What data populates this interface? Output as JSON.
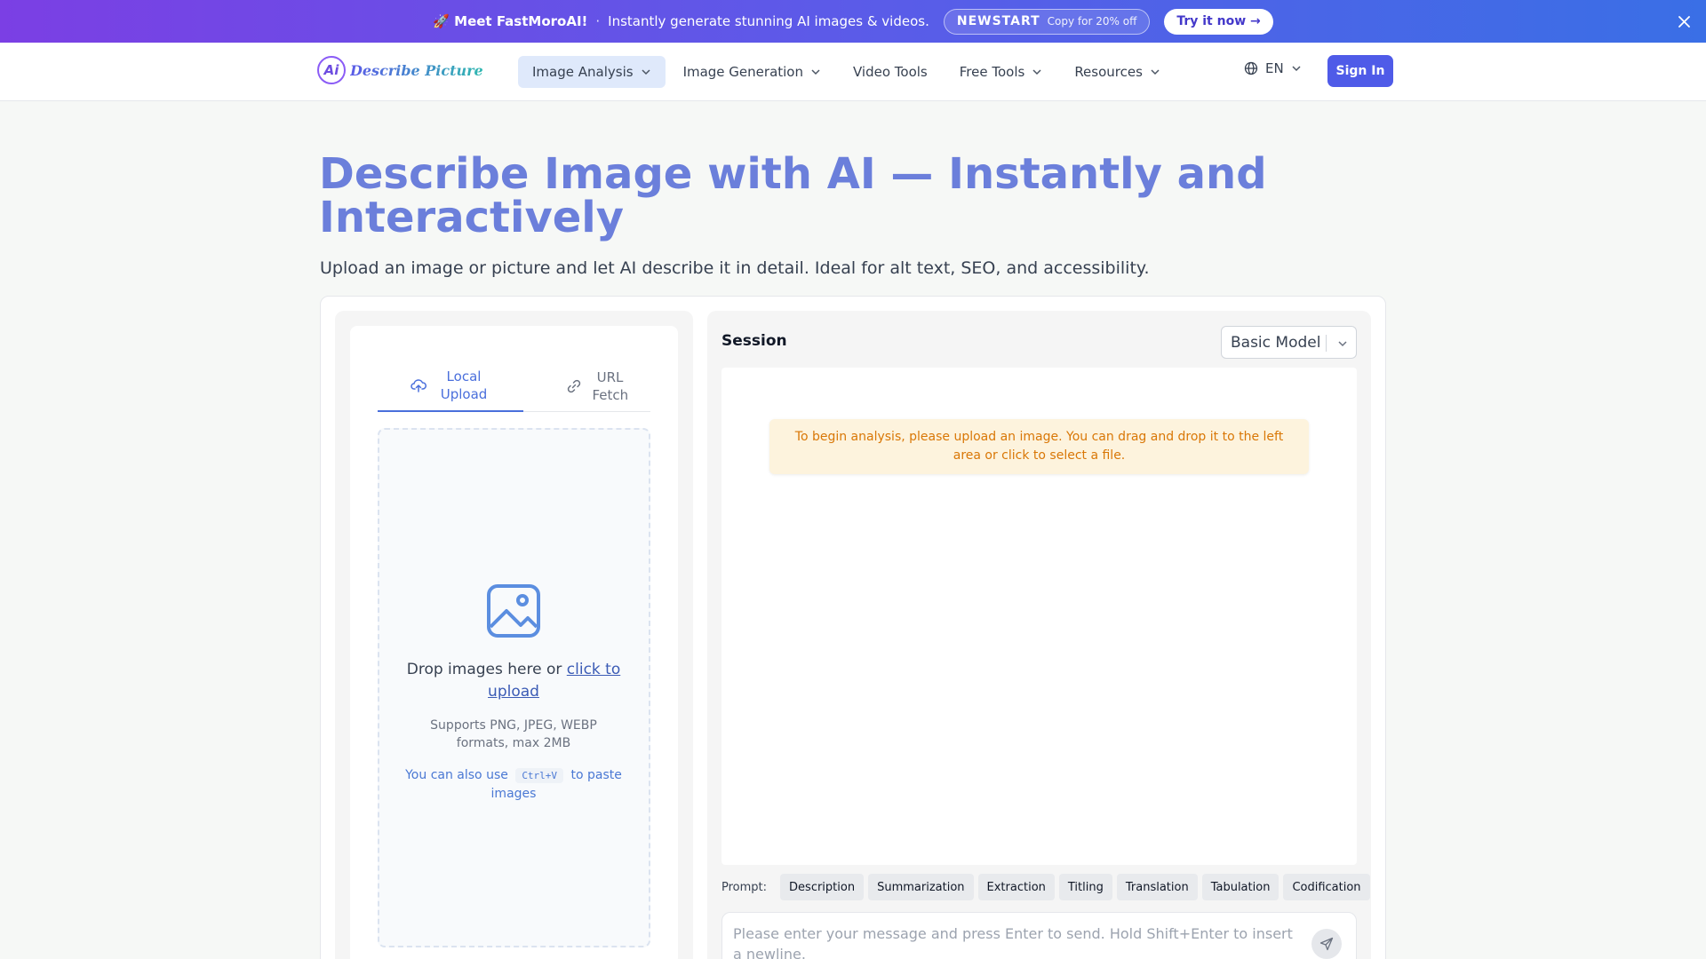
{
  "promo": {
    "lead": "🚀 Meet FastMoroAI!",
    "separator": "·",
    "text": "Instantly generate stunning AI images & videos.",
    "code": "NEWSTART",
    "code_hint": "Copy for 20% off",
    "cta": "Try it now →"
  },
  "nav": {
    "logo_mark": "Ai",
    "logo_text": "Describe Picture",
    "items": [
      {
        "label": "Image Analysis"
      },
      {
        "label": "Image Generation"
      },
      {
        "label": "Video Tools"
      },
      {
        "label": "Free Tools"
      },
      {
        "label": "Resources"
      }
    ],
    "language": "EN",
    "signin": "Sign In"
  },
  "hero": {
    "title": "Describe Image with AI — Instantly and Interactively",
    "subtitle": "Upload an image or picture and let AI describe it in detail. Ideal for alt text, SEO, and accessibility."
  },
  "upload": {
    "tabs": [
      {
        "label": "Local Upload"
      },
      {
        "label": "URL Fetch"
      }
    ],
    "drop_text": "Drop images here or",
    "click_link": "click to upload",
    "support": "Supports PNG, JPEG, WEBP formats, max 2MB",
    "paste_prefix": "You can also use",
    "paste_key": "Ctrl+V",
    "paste_suffix": "to paste images"
  },
  "session": {
    "title": "Session",
    "model": "Basic Model",
    "notice": "To begin analysis, please upload an image. You can drag and drop it to the left area or click to select a file.",
    "prompt_label": "Prompt:",
    "prompts": [
      "Description",
      "Summarization",
      "Extraction",
      "Titling",
      "Translation",
      "Tabulation",
      "Codification"
    ],
    "input_placeholder": "Please enter your message and press Enter to send. Hold Shift+Enter to insert a newline."
  },
  "colors": {
    "accent": "#4f5be8",
    "hero_title": "#6b7fdb",
    "notice_text": "#d97706",
    "notice_bg": "#fdf3dd"
  }
}
